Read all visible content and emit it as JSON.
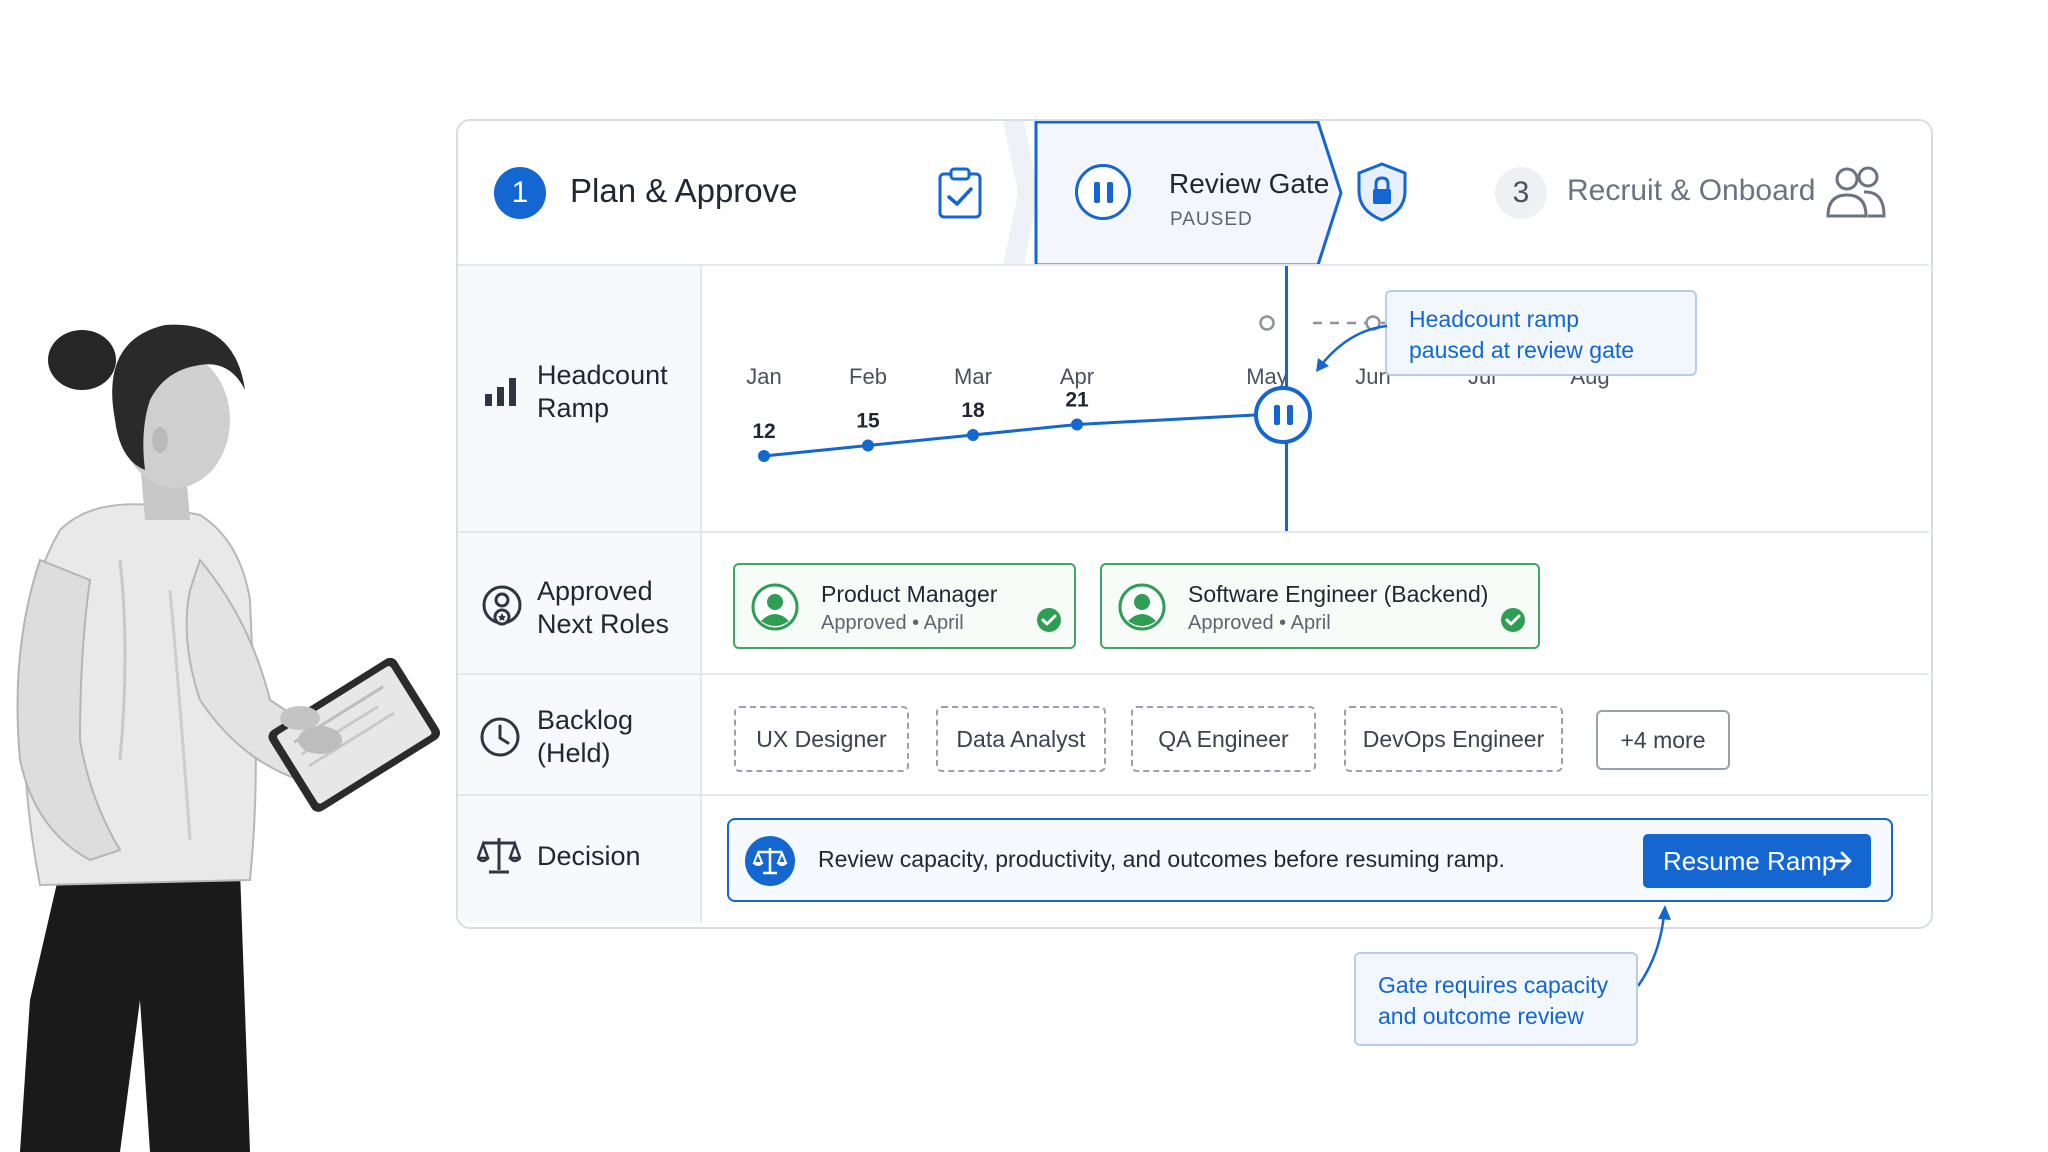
{
  "stepper": {
    "step1": {
      "number": "1",
      "title": "Plan & Approve",
      "icon": "clipboard-check-icon"
    },
    "step2": {
      "title": "Review Gate",
      "status": "PAUSED",
      "icon": "shield-lock-icon"
    },
    "step3": {
      "number": "3",
      "title": "Recruit & Onboard",
      "icon": "users-icon"
    }
  },
  "rows": {
    "headcount": {
      "label_line1": "Headcount",
      "label_line2": "Ramp",
      "icon": "bar-chart-icon"
    },
    "approved": {
      "label_line1": "Approved",
      "label_line2": "Next Roles",
      "icon": "user-badge-icon"
    },
    "backlog": {
      "label_line1": "Backlog",
      "label_line2": "(Held)",
      "icon": "clock-icon"
    },
    "decision": {
      "label": "Decision",
      "icon": "scale-icon"
    }
  },
  "chart_data": {
    "type": "line",
    "x": [
      "Jan",
      "Feb",
      "Mar",
      "Apr",
      "May",
      "Jun",
      "Jul",
      "Aug"
    ],
    "series": [
      {
        "values": [
          12,
          15,
          18,
          21,
          null,
          null,
          null,
          null
        ]
      }
    ],
    "pause_marker": "between Apr and May",
    "future_months": [
      "May",
      "Jun",
      "Jul",
      "Aug"
    ],
    "grid": false
  },
  "callouts": {
    "ramp_line1": "Headcount ramp",
    "ramp_line2": "paused at review gate",
    "gate_line1": "Gate requires capacity",
    "gate_line2": "and outcome review"
  },
  "approved_roles": [
    {
      "title": "Product Manager",
      "status": "Approved",
      "month": "April"
    },
    {
      "title": "Software Engineer (Backend)",
      "status": "Approved",
      "month": "April"
    }
  ],
  "backlog": {
    "items": [
      "UX Designer",
      "Data Analyst",
      "QA Engineer",
      "DevOps Engineer"
    ],
    "more": "+4 more"
  },
  "decision": {
    "text": "Review capacity, productivity, and outcomes before resuming ramp.",
    "button": "Resume Ramp",
    "button_icon": "arrow-right-icon"
  },
  "colors": {
    "accent": "#1466d0",
    "approved": "#2e9e55",
    "border": "#d9dee6",
    "muted": "#9aa1ad"
  }
}
